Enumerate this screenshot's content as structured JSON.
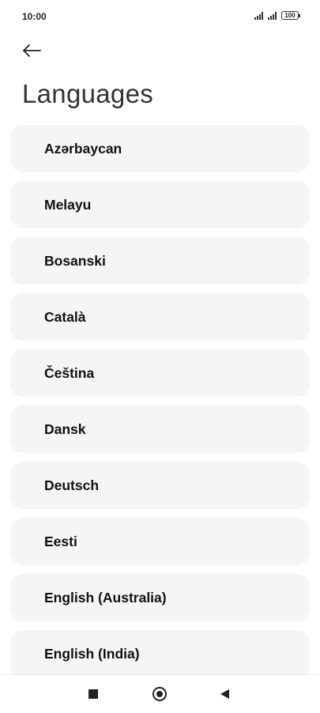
{
  "status_bar": {
    "time": "10:00",
    "battery": "100",
    "icons": [
      "signal-icon",
      "signal-icon",
      "battery-icon"
    ]
  },
  "header": {
    "back_icon": "back-arrow-icon",
    "title": "Languages"
  },
  "languages": [
    {
      "label": "Azərbaycan"
    },
    {
      "label": "Melayu"
    },
    {
      "label": "Bosanski"
    },
    {
      "label": "Català"
    },
    {
      "label": "Čeština"
    },
    {
      "label": "Dansk"
    },
    {
      "label": "Deutsch"
    },
    {
      "label": "Eesti"
    },
    {
      "label": "English (Australia)"
    },
    {
      "label": "English (India)"
    }
  ],
  "nav_bar": {
    "icons": [
      "recents-square-icon",
      "home-circle-icon",
      "back-triangle-icon"
    ]
  },
  "colors": {
    "item_background": "#f5f5f5",
    "text": "#111111",
    "title": "#333333"
  }
}
